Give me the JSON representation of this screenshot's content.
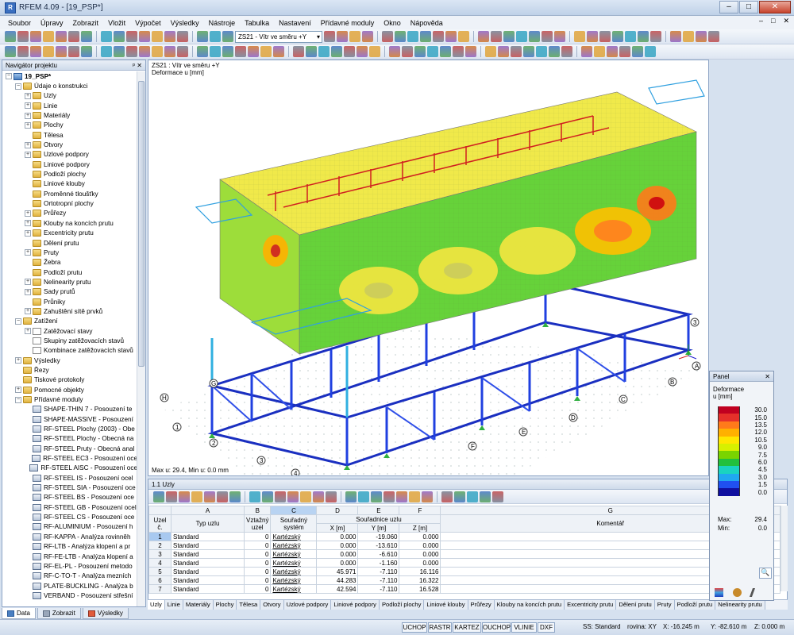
{
  "app": {
    "title": "RFEM 4.09 - [19_PSP*]",
    "menu": [
      "Soubor",
      "Úpravy",
      "Zobrazit",
      "Vložit",
      "Výpočet",
      "Výsledky",
      "Nástroje",
      "Tabulka",
      "Nastavení",
      "Přídavné moduly",
      "Okno",
      "Nápověda"
    ],
    "load_case": "ZS21 - Vítr ve směru +Y",
    "window_buttons": {
      "min": "–",
      "max": "□",
      "close": "✕"
    },
    "mdi_buttons": {
      "min": "–",
      "max": "□",
      "close": "✕"
    }
  },
  "navigator": {
    "title": "Navigátor projektu",
    "header_buttons": "ᵖ  ✕",
    "items": [
      {
        "label": "19_PSP*",
        "level": 0,
        "icon": "root",
        "exp": "−"
      },
      {
        "label": "Údaje o konstrukci",
        "level": 1,
        "icon": "folder",
        "exp": "−"
      },
      {
        "label": "Uzly",
        "level": 2,
        "icon": "folder",
        "exp": "+"
      },
      {
        "label": "Linie",
        "level": 2,
        "icon": "folder",
        "exp": "+"
      },
      {
        "label": "Materiály",
        "level": 2,
        "icon": "folder",
        "exp": "+"
      },
      {
        "label": "Plochy",
        "level": 2,
        "icon": "folder",
        "exp": "+"
      },
      {
        "label": "Tělesa",
        "level": 2,
        "icon": "folder",
        "exp": ""
      },
      {
        "label": "Otvory",
        "level": 2,
        "icon": "folder",
        "exp": "+"
      },
      {
        "label": "Uzlové podpory",
        "level": 2,
        "icon": "folder",
        "exp": "+"
      },
      {
        "label": "Liniové podpory",
        "level": 2,
        "icon": "folder",
        "exp": ""
      },
      {
        "label": "Podloží plochy",
        "level": 2,
        "icon": "folder",
        "exp": ""
      },
      {
        "label": "Liniové klouby",
        "level": 2,
        "icon": "folder",
        "exp": ""
      },
      {
        "label": "Proměnné tloušťky",
        "level": 2,
        "icon": "folder",
        "exp": ""
      },
      {
        "label": "Ortotropní plochy",
        "level": 2,
        "icon": "folder",
        "exp": ""
      },
      {
        "label": "Průřezy",
        "level": 2,
        "icon": "folder",
        "exp": "+"
      },
      {
        "label": "Klouby na koncích prutu",
        "level": 2,
        "icon": "folder",
        "exp": "+"
      },
      {
        "label": "Excentricity prutu",
        "level": 2,
        "icon": "folder",
        "exp": "+"
      },
      {
        "label": "Dělení prutu",
        "level": 2,
        "icon": "folder",
        "exp": ""
      },
      {
        "label": "Pruty",
        "level": 2,
        "icon": "folder",
        "exp": "+"
      },
      {
        "label": "Žebra",
        "level": 2,
        "icon": "folder",
        "exp": ""
      },
      {
        "label": "Podloží prutu",
        "level": 2,
        "icon": "folder",
        "exp": ""
      },
      {
        "label": "Nelinearity prutu",
        "level": 2,
        "icon": "folder",
        "exp": "+"
      },
      {
        "label": "Sady prutů",
        "level": 2,
        "icon": "folder",
        "exp": "+"
      },
      {
        "label": "Průniky",
        "level": 2,
        "icon": "folder",
        "exp": ""
      },
      {
        "label": "Zahuštění sítě prvků",
        "level": 2,
        "icon": "folder",
        "exp": "+"
      },
      {
        "label": "Zatížení",
        "level": 1,
        "icon": "folder",
        "exp": "−"
      },
      {
        "label": "Zatěžovací stavy",
        "level": 2,
        "icon": "arrow",
        "exp": "+"
      },
      {
        "label": "Skupiny zatěžovacích stavů",
        "level": 2,
        "icon": "arrow",
        "exp": ""
      },
      {
        "label": "Kombinace zatěžovacích stavů",
        "level": 2,
        "icon": "arrow",
        "exp": ""
      },
      {
        "label": "Výsledky",
        "level": 1,
        "icon": "folder",
        "exp": "+"
      },
      {
        "label": "Řezy",
        "level": 1,
        "icon": "folder",
        "exp": ""
      },
      {
        "label": "Tiskové protokoly",
        "level": 1,
        "icon": "folder",
        "exp": ""
      },
      {
        "label": "Pomocné objekty",
        "level": 1,
        "icon": "folder",
        "exp": "+"
      },
      {
        "label": "Přídavné moduly",
        "level": 1,
        "icon": "folder",
        "exp": "−"
      },
      {
        "label": "SHAPE-THIN 7 - Posouzení te",
        "level": 2,
        "icon": "mod",
        "exp": ""
      },
      {
        "label": "SHAPE-MASSIVE - Posouzení",
        "level": 2,
        "icon": "mod",
        "exp": ""
      },
      {
        "label": "RF-STEEL Plochy (2003) - Obe",
        "level": 2,
        "icon": "mod",
        "exp": ""
      },
      {
        "label": "RF-STEEL Plochy - Obecná na",
        "level": 2,
        "icon": "mod",
        "exp": ""
      },
      {
        "label": "RF-STEEL Pruty - Obecná anal",
        "level": 2,
        "icon": "mod",
        "exp": ""
      },
      {
        "label": "RF-STEEL EC3 - Posouzení oce",
        "level": 2,
        "icon": "mod",
        "exp": ""
      },
      {
        "label": "RF-STEEL AISC - Posouzení oce",
        "level": 2,
        "icon": "mod",
        "exp": ""
      },
      {
        "label": "RF-STEEL IS - Posouzení ocel",
        "level": 2,
        "icon": "mod",
        "exp": ""
      },
      {
        "label": "RF-STEEL SIA - Posouzení oce",
        "level": 2,
        "icon": "mod",
        "exp": ""
      },
      {
        "label": "RF-STEEL BS - Posouzení oce",
        "level": 2,
        "icon": "mod",
        "exp": ""
      },
      {
        "label": "RF-STEEL GB - Posouzení ocel",
        "level": 2,
        "icon": "mod",
        "exp": ""
      },
      {
        "label": "RF-STEEL CS - Posouzení oce",
        "level": 2,
        "icon": "mod",
        "exp": ""
      },
      {
        "label": "RF-ALUMINIUM - Posouzení h",
        "level": 2,
        "icon": "mod",
        "exp": ""
      },
      {
        "label": "RF-KAPPA - Analýza rovinněh",
        "level": 2,
        "icon": "mod",
        "exp": ""
      },
      {
        "label": "RF-LTB - Analýza klopení a pr",
        "level": 2,
        "icon": "mod",
        "exp": ""
      },
      {
        "label": "RF-FE-LTB - Analýza klopení a",
        "level": 2,
        "icon": "mod",
        "exp": ""
      },
      {
        "label": "RF-EL-PL - Posouzení metodo",
        "level": 2,
        "icon": "mod",
        "exp": ""
      },
      {
        "label": "RF-C-TO-T - Analýza mezních",
        "level": 2,
        "icon": "mod",
        "exp": ""
      },
      {
        "label": "PLATE-BUCKLING - Analýza b",
        "level": 2,
        "icon": "mod",
        "exp": ""
      },
      {
        "label": "VERBAND - Posouzení střešní",
        "level": 2,
        "icon": "mod",
        "exp": ""
      }
    ],
    "tabs": [
      "Data",
      "Zobrazit",
      "Výsledky"
    ]
  },
  "viewport": {
    "line1": "ZS21 : Vítr ve směru +Y",
    "line2": "Deformace u [mm]",
    "footer": "Max u: 29.4, Min u: 0.0 mm",
    "axis_labels": [
      "A",
      "B",
      "C",
      "D",
      "E",
      "F",
      "G",
      "H",
      "1",
      "2",
      "3",
      "4"
    ]
  },
  "table": {
    "title": "1.1 Uzly",
    "col_letters": [
      "A",
      "B",
      "C",
      "D",
      "E",
      "F",
      "G"
    ],
    "headers": {
      "uzel": "Uzel č.",
      "typ": "Typ uzlu",
      "vztazny": "Vztažný uzel",
      "soustava": "Souřadný systém",
      "souradnice": "Souřadnice uzlu",
      "x": "X [m]",
      "y": "Y [m]",
      "z": "Z [m]",
      "komentar": "Komentář"
    },
    "rows": [
      {
        "n": "1",
        "typ": "Standard",
        "ref": "0",
        "sys": "Kartézský",
        "x": "0.000",
        "y": "-19.060",
        "z": "0.000"
      },
      {
        "n": "2",
        "typ": "Standard",
        "ref": "0",
        "sys": "Kartézský",
        "x": "0.000",
        "y": "-13.610",
        "z": "0.000"
      },
      {
        "n": "3",
        "typ": "Standard",
        "ref": "0",
        "sys": "Kartézský",
        "x": "0.000",
        "y": "-6.610",
        "z": "0.000"
      },
      {
        "n": "4",
        "typ": "Standard",
        "ref": "0",
        "sys": "Kartézský",
        "x": "0.000",
        "y": "-1.160",
        "z": "0.000"
      },
      {
        "n": "5",
        "typ": "Standard",
        "ref": "0",
        "sys": "Kartézský",
        "x": "45.971",
        "y": "-7.110",
        "z": "16.116"
      },
      {
        "n": "6",
        "typ": "Standard",
        "ref": "0",
        "sys": "Kartézský",
        "x": "44.283",
        "y": "-7.110",
        "z": "16.322"
      },
      {
        "n": "7",
        "typ": "Standard",
        "ref": "0",
        "sys": "Kartézský",
        "x": "42.594",
        "y": "-7.110",
        "z": "16.528"
      }
    ],
    "sheet_tabs": [
      "Uzly",
      "Linie",
      "Materiály",
      "Plochy",
      "Tělesa",
      "Otvory",
      "Uzlové podpory",
      "Liniové podpory",
      "Podloží plochy",
      "Liniové klouby",
      "Průřezy",
      "Klouby na koncích prutu",
      "Excentricity prutu",
      "Dělení prutu",
      "Pruty",
      "Podloží prutu",
      "Nelinearity prutu"
    ]
  },
  "panel": {
    "title": "Panel",
    "label1": "Deformace",
    "label2": "u [mm]",
    "scale": [
      {
        "value": "30.0",
        "color": "#c00020"
      },
      {
        "value": "15.0",
        "color": "#e5302a"
      },
      {
        "value": "13.5",
        "color": "#ff7a1a"
      },
      {
        "value": "12.0",
        "color": "#ffb000"
      },
      {
        "value": "10.5",
        "color": "#ffe600"
      },
      {
        "value": "9.0",
        "color": "#d7f000"
      },
      {
        "value": "7.5",
        "color": "#7ad400"
      },
      {
        "value": "6.0",
        "color": "#22c03c"
      },
      {
        "value": "4.5",
        "color": "#1ad3c0"
      },
      {
        "value": "3.0",
        "color": "#20a8f0"
      },
      {
        "value": "1.5",
        "color": "#2050f0"
      },
      {
        "value": "0.0",
        "color": "#1010a0"
      }
    ],
    "max_label": "Max:",
    "max_value": "29.4",
    "min_label": "Min:",
    "min_value": "0.0"
  },
  "statusbar": {
    "buttons": [
      "UCHOP",
      "RASTR",
      "KARTEZ",
      "OUCHOP",
      "VLINIE",
      "DXF"
    ],
    "ss": "SS: Standard",
    "plane": "rovina: XY",
    "x": "X: -16.245 m",
    "y": "Y: -82.610 m",
    "z": "Z: 0.000 m"
  }
}
